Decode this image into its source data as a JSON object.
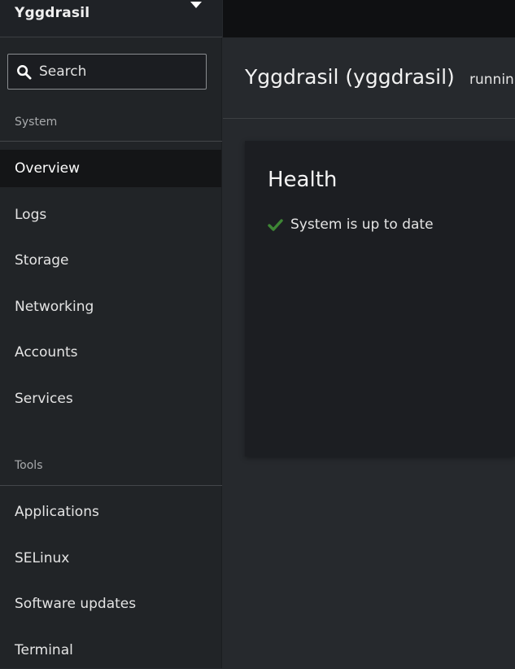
{
  "sidebar": {
    "host_name": "Yggdrasil",
    "search": {
      "placeholder": "Search",
      "value": ""
    },
    "sections": [
      {
        "label": "System",
        "items": [
          {
            "label": "Overview",
            "active": true
          },
          {
            "label": "Logs"
          },
          {
            "label": "Storage"
          },
          {
            "label": "Networking"
          },
          {
            "label": "Accounts"
          },
          {
            "label": "Services"
          }
        ]
      },
      {
        "label": "Tools",
        "items": [
          {
            "label": "Applications"
          },
          {
            "label": "SELinux"
          },
          {
            "label": "Software updates"
          },
          {
            "label": "Terminal"
          }
        ]
      }
    ]
  },
  "header": {
    "title": "Yggdrasil (yggdrasil)",
    "status": "runnin"
  },
  "health_card": {
    "title": "Health",
    "status_icon": "check-icon",
    "status_text": "System is up to date"
  },
  "colors": {
    "accent_success": "#3e8635",
    "active_nav_bg": "#141517"
  }
}
